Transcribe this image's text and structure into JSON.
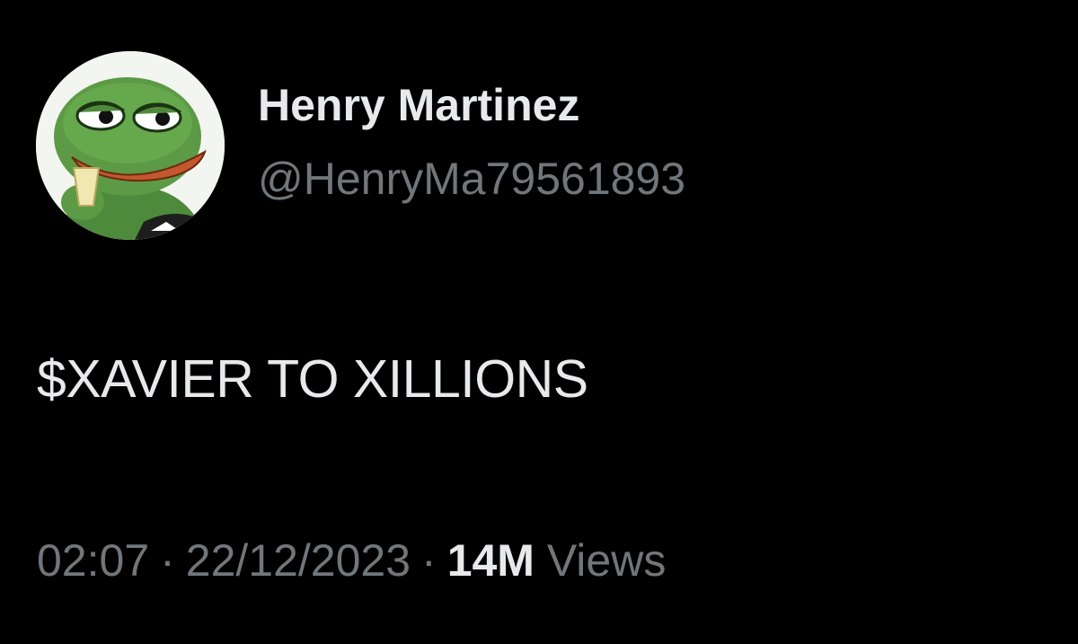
{
  "tweet": {
    "author": {
      "display_name": "Henry Martinez",
      "handle": "@HenryMa79561893",
      "avatar_icon": "pepe-frog-avatar"
    },
    "text": "$XAVIER TO XILLIONS",
    "meta": {
      "time": "02:07",
      "separator": "·",
      "date": "22/12/2023",
      "views_count": "14M",
      "views_label": "Views"
    }
  },
  "colors": {
    "background": "#000000",
    "primary_text": "#e7e9ea",
    "secondary_text": "#71767b"
  }
}
